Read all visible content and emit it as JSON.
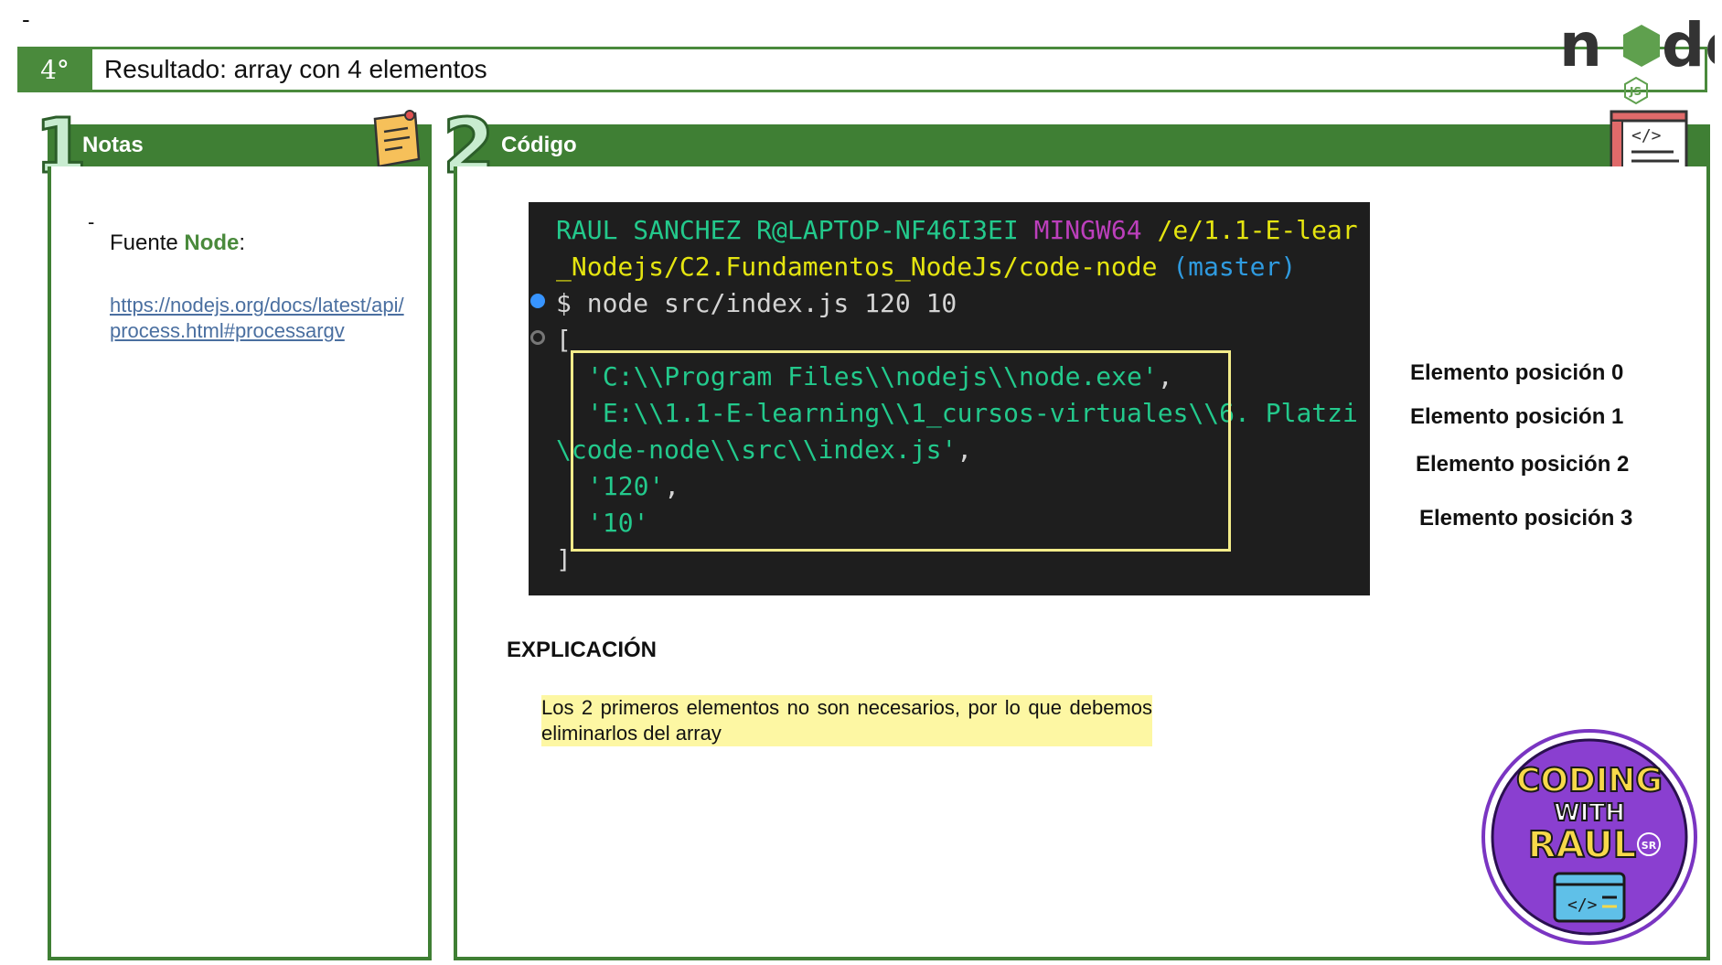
{
  "page": {
    "top_dash": "-",
    "step_number": "4°",
    "title": "Resultado: array con 4 elementos"
  },
  "notes": {
    "section_number": "1",
    "header": "Notas",
    "dash": "-",
    "source_prefix": "Fuente ",
    "source_name": "Node",
    "source_suffix": ":",
    "link": "https://nodejs.org/docs/latest/api/process.html#processargv"
  },
  "code": {
    "section_number": "2",
    "header": "Código",
    "terminal": {
      "user": "RAUL SANCHEZ R@LAPTOP-NF46I3EI",
      "shell": "MINGW64",
      "path_line1": "/e/1.1-E-lear",
      "path_line2": "_Nodejs/C2.Fundamentos_NodeJs/code-node",
      "branch": "(master)",
      "command": "$ node src/index.js 120 10",
      "open_bracket": "[",
      "item0": "'C:\\\\Program Files\\\\nodejs\\\\node.exe'",
      "item1_part1": "'E:\\\\1.1-E-learning\\\\1_cursos-virtuales\\\\6. Platzi",
      "item1_part2": "\\code-node\\\\src\\\\index.js'",
      "item2": "'120'",
      "item3": "'10'",
      "comma": ",",
      "close_bracket": "]"
    },
    "element_labels": [
      "Elemento posición 0",
      "Elemento posición 1",
      "Elemento posición 2",
      "Elemento posición 3"
    ],
    "explanation_title": "EXPLICACIÓN",
    "explanation_text": "Los 2 primeros elementos no son necesarios, por lo que debemos eliminarlos del array"
  },
  "branding": {
    "node_logo_text": "node",
    "node_logo_badge": "JS",
    "badge_line1": "CODING",
    "badge_line2": "WITH",
    "badge_line3": "RAUL",
    "badge_sr": "SR",
    "colors": {
      "primary_green": "#3f7f34",
      "title_green": "#4a8a3c",
      "terminal_bg": "#1e1e1e",
      "highlight_yellow": "#fdf7a3",
      "badge_purple": "#8a3fd0"
    }
  }
}
